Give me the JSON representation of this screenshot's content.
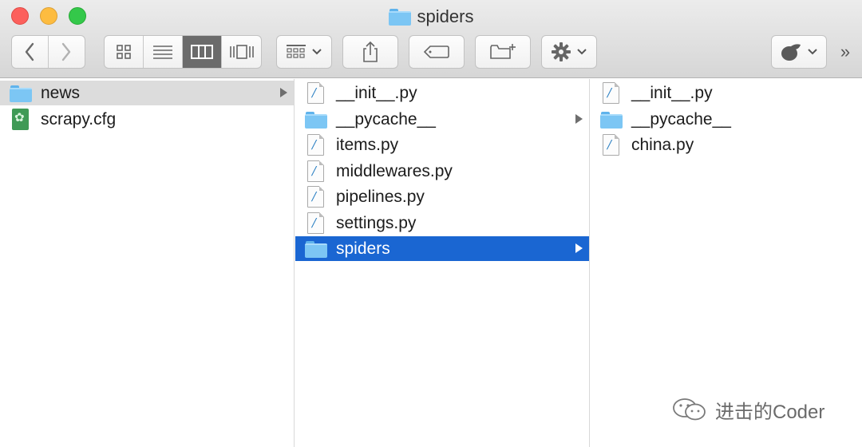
{
  "window": {
    "title": "spiders",
    "title_icon": "folder-icon"
  },
  "toolbar": {
    "back_icon": "chevron-left-icon",
    "forward_icon": "chevron-right-icon",
    "view_modes": [
      "icon-view-icon",
      "list-view-icon",
      "column-view-icon",
      "cover-flow-icon"
    ],
    "active_view": "column-view-icon",
    "arrange_icon": "arrange-grid-icon",
    "share_icon": "share-icon",
    "tag_icon": "tag-icon",
    "new_folder_icon": "new-folder-icon",
    "action_icon": "gear-icon",
    "extension_icon": "acorn-icon",
    "overflow_label": "»"
  },
  "columns": [
    {
      "items": [
        {
          "name": "news",
          "kind": "folder",
          "has_children": true,
          "selected": "gray"
        },
        {
          "name": "scrapy.cfg",
          "kind": "cfg",
          "has_children": false,
          "selected": "none"
        }
      ]
    },
    {
      "items": [
        {
          "name": "__init__.py",
          "kind": "python",
          "has_children": false,
          "selected": "none"
        },
        {
          "name": "__pycache__",
          "kind": "folder",
          "has_children": true,
          "selected": "none"
        },
        {
          "name": "items.py",
          "kind": "python",
          "has_children": false,
          "selected": "none"
        },
        {
          "name": "middlewares.py",
          "kind": "python",
          "has_children": false,
          "selected": "none"
        },
        {
          "name": "pipelines.py",
          "kind": "python",
          "has_children": false,
          "selected": "none"
        },
        {
          "name": "settings.py",
          "kind": "python",
          "has_children": false,
          "selected": "none"
        },
        {
          "name": "spiders",
          "kind": "folder",
          "has_children": true,
          "selected": "blue"
        }
      ]
    },
    {
      "items": [
        {
          "name": "__init__.py",
          "kind": "python",
          "has_children": false,
          "selected": "none"
        },
        {
          "name": "__pycache__",
          "kind": "folder",
          "has_children": false,
          "selected": "none"
        },
        {
          "name": "china.py",
          "kind": "python",
          "has_children": false,
          "selected": "none"
        }
      ]
    }
  ],
  "colors": {
    "selection_blue": "#1a66d2",
    "selection_gray": "#dcdcdc",
    "folder_blue": "#7cc6f4"
  },
  "watermark": {
    "text": "进击的Coder",
    "icon": "wechat-icon"
  }
}
